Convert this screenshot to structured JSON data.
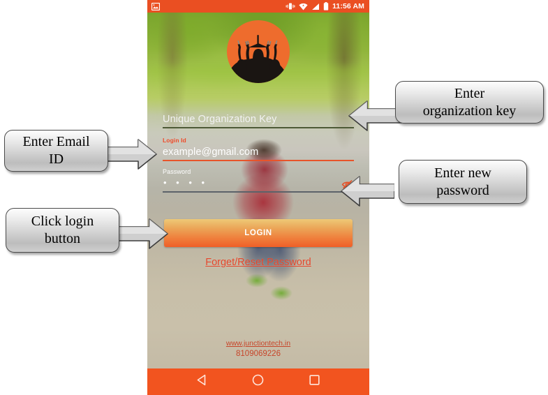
{
  "page": {
    "title": "Mobile app login screen with annotation callouts"
  },
  "phone": {
    "statusbar": {
      "screenshot_icon": "image-icon",
      "vibrate_icon": "vibrate-icon",
      "wifi_icon": "wifi-icon",
      "signal_icon": "signal-icon",
      "battery_icon": "battery-icon",
      "time": "11:56 AM"
    },
    "logo": {
      "name": "junction-tech-logo",
      "description": "graduates silhouette in orange circle",
      "circle_color": "#EE6C2D",
      "silhouette_color": "#1A1512"
    },
    "form": {
      "org_key": {
        "label": "",
        "placeholder": "Unique Organization Key",
        "value": "Unique Organization Key",
        "underline_color": "#4D5A36"
      },
      "login_id": {
        "label": "Login Id",
        "placeholder": "example@gmail.com",
        "value": "example@gmail.com",
        "underline_color": "#E8542A",
        "label_color": "#EF4B2A"
      },
      "password": {
        "label": "Password",
        "value": "• • • •",
        "masked_length": 4,
        "underline_color": "#5C6269",
        "toggle_icon": "eye-off-icon",
        "toggle_icon_color": "#E5522A"
      }
    },
    "login_button": {
      "label": "LOGIN",
      "color_top": "#EEC977",
      "color_bottom": "#EF5F28"
    },
    "forget_link": {
      "label": "Forget/Reset Password",
      "color": "#E4452A"
    },
    "footer": {
      "url": "www.junctiontech.in",
      "phone": "8109069226",
      "color": "#C7452A"
    },
    "navbar": {
      "back_icon": "back-triangle-icon",
      "home_icon": "home-circle-icon",
      "recents_icon": "recents-square-icon",
      "background": "#F2541F"
    }
  },
  "callouts": [
    {
      "id": "email",
      "lines": [
        "Enter Email",
        "ID"
      ],
      "arrow": "arrow-right",
      "side": "left"
    },
    {
      "id": "login",
      "lines": [
        "Click login",
        "button"
      ],
      "arrow": "arrow-right",
      "side": "left"
    },
    {
      "id": "org",
      "lines": [
        "Enter",
        "organization key"
      ],
      "arrow": "arrow-left",
      "side": "right"
    },
    {
      "id": "password",
      "lines": [
        "Enter new",
        "password"
      ],
      "arrow": "arrow-left",
      "side": "right"
    }
  ]
}
